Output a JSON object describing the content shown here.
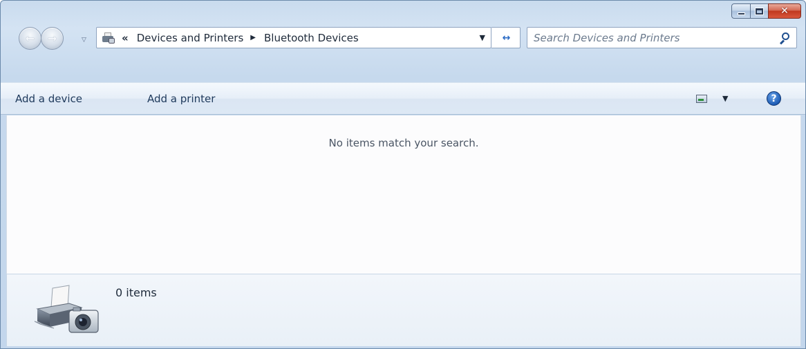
{
  "window": {
    "caption": {
      "minimize_icon": "minimize-icon",
      "maximize_icon": "maximize-icon",
      "close_icon": "close-icon",
      "close_glyph": "✕"
    }
  },
  "navigation": {
    "back_glyph": "←",
    "forward_glyph": "→",
    "history_glyph": "▽",
    "address": {
      "overflow_glyph": "«",
      "breadcrumbs": [
        "Devices and Printers",
        "Bluetooth Devices"
      ],
      "separator_glyph": "▶",
      "dropdown_glyph": "▼"
    },
    "refresh_glyph": "↔",
    "search": {
      "placeholder": "Search Devices and Printers",
      "value": ""
    }
  },
  "command_bar": {
    "add_device_label": "Add a device",
    "add_printer_label": "Add a printer",
    "view_dropdown_glyph": "▼",
    "help_glyph": "?"
  },
  "content": {
    "empty_message": "No items match your search."
  },
  "details": {
    "item_count": "0 items"
  }
}
